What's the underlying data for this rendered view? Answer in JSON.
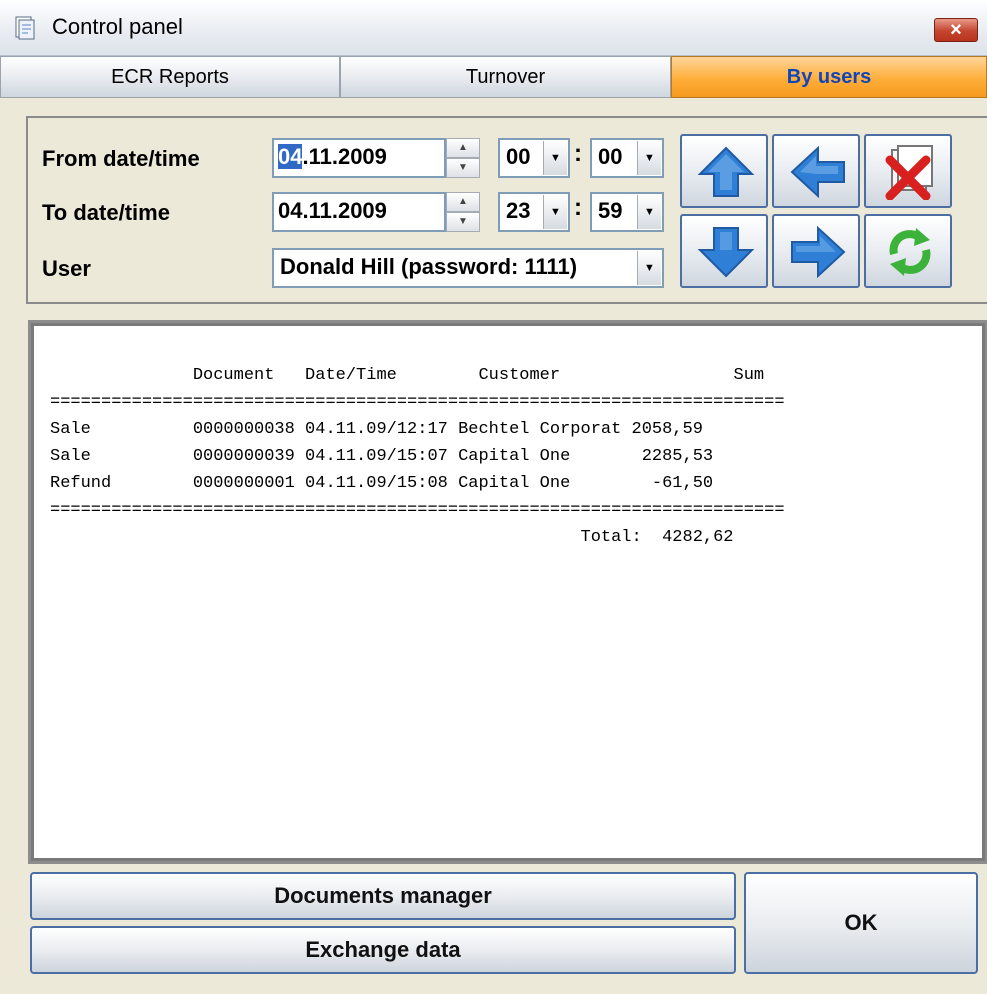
{
  "window": {
    "title": "Control panel",
    "close_label": "×"
  },
  "tabs": [
    {
      "label": "ECR Reports",
      "active": false
    },
    {
      "label": "Turnover",
      "active": false
    },
    {
      "label": "By users",
      "active": true
    }
  ],
  "filters": {
    "from_label": "From date/time",
    "to_label": "To date/time",
    "user_label": "User",
    "from_date_selected": "04",
    "from_date_rest": ".11.2009",
    "from_hour": "00",
    "from_minute": "00",
    "to_date": "04.11.2009",
    "to_hour": "23",
    "to_minute": "59",
    "user_value": "Donald Hill (password: 1111)",
    "colon": ":"
  },
  "nav_buttons": [
    {
      "icon": "arrow-up-icon"
    },
    {
      "icon": "arrow-left-icon"
    },
    {
      "icon": "delete-icon"
    },
    {
      "icon": "arrow-down-icon"
    },
    {
      "icon": "arrow-right-icon"
    },
    {
      "icon": "refresh-icon"
    }
  ],
  "report": {
    "header": "              Document   Date/Time        Customer                 Sum",
    "separator": "========================================================================",
    "rows": [
      "Sale          0000000038 04.11.09/12:17 Bechtel Corporat 2058,59",
      "Sale          0000000039 04.11.09/15:07 Capital One       2285,53",
      "Refund        0000000001 04.11.09/15:08 Capital One        -61,50"
    ],
    "total": "                                                    Total:  4282,62"
  },
  "buttons": {
    "documents_manager": "Documents manager",
    "exchange_data": "Exchange data",
    "ok": "OK"
  },
  "colors": {
    "active_tab": "#ffae3a",
    "active_tab_text": "#1146b8",
    "arrow_blue": "#2f7fd6",
    "delete_red": "#d8201e",
    "refresh_green": "#3cb23a"
  }
}
